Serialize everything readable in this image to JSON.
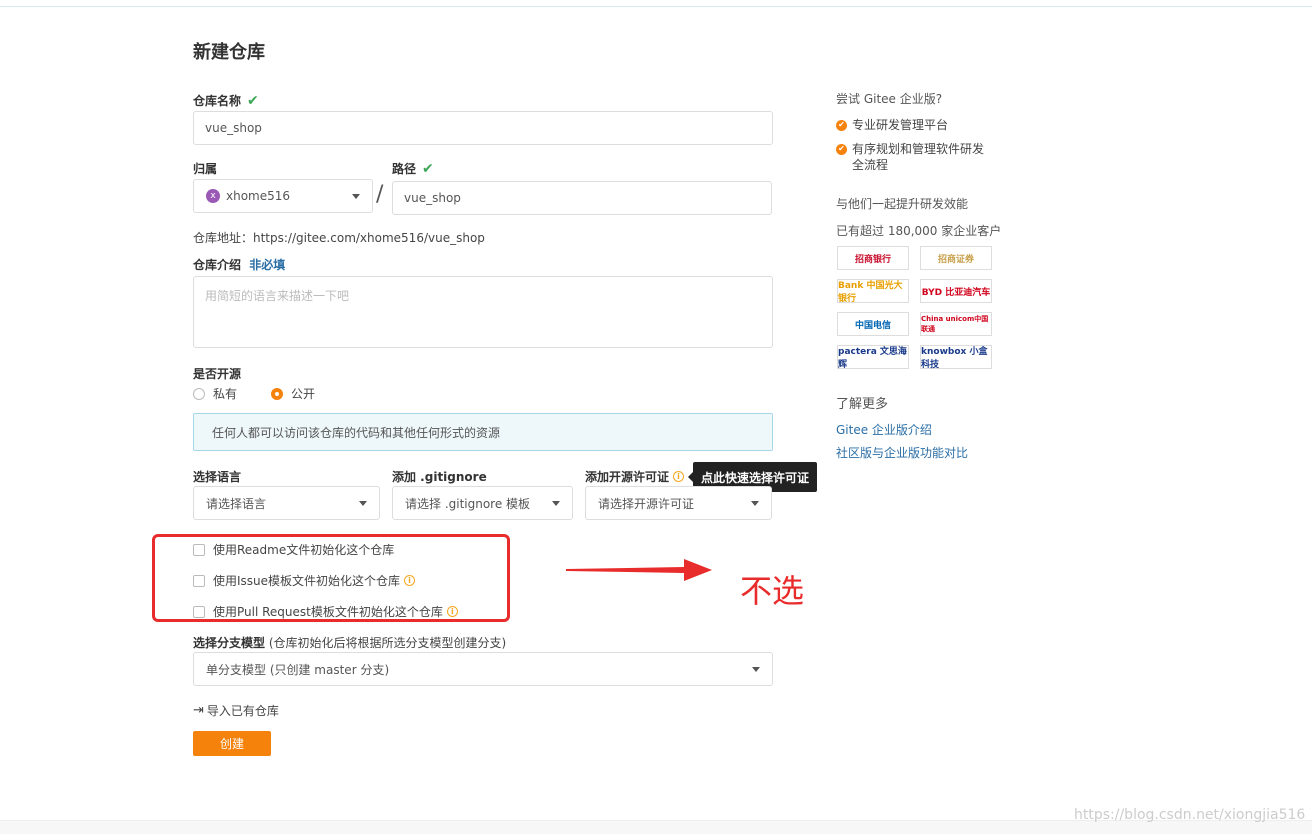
{
  "page": {
    "title": "新建仓库"
  },
  "repo_name": {
    "label": "仓库名称",
    "value": "vue_shop"
  },
  "owner": {
    "label": "归属",
    "avatar_letter": "x",
    "value": "xhome516"
  },
  "path": {
    "label": "路径",
    "separator": "/",
    "value": "vue_shop"
  },
  "repo_url": {
    "text": "仓库地址：https://gitee.com/xhome516/vue_shop"
  },
  "description": {
    "label": "仓库介绍",
    "optional": "非必填",
    "placeholder": "用简短的语言来描述一下吧"
  },
  "visibility": {
    "label": "是否开源",
    "private_label": "私有",
    "public_label": "公开",
    "selected": "公开",
    "notice": "任何人都可以访问该仓库的代码和其他任何形式的资源"
  },
  "language": {
    "label": "选择语言",
    "value": "请选择语言"
  },
  "gitignore": {
    "label": "添加 .gitignore",
    "value": "请选择 .gitignore 模板"
  },
  "license": {
    "label": "添加开源许可证",
    "value": "请选择开源许可证",
    "tooltip": "点此快速选择许可证"
  },
  "init_options": [
    {
      "label": "使用Readme文件初始化这个仓库",
      "checked": false
    },
    {
      "label": "使用Issue模板文件初始化这个仓库",
      "checked": false
    },
    {
      "label": "使用Pull Request模板文件初始化这个仓库",
      "checked": false
    }
  ],
  "annotation": {
    "text": "不选",
    "color": "#e82b2b"
  },
  "branch_model": {
    "label": "选择分支模型",
    "hint": "(仓库初始化后将根据所选分支模型创建分支)",
    "value": "单分支模型 (只创建 master 分支)"
  },
  "import_link": "导入已有仓库",
  "create_button": "创建",
  "sidebar": {
    "try_title": "尝试 Gitee 企业版?",
    "features": [
      "专业研发管理平台",
      "有序规划和管理软件研发",
      "全流程"
    ],
    "together": "与他们一起提升研发效能",
    "customers": "已有超过 180,000 家企业客户",
    "logos": [
      "招商银行",
      "招商证券",
      "Bank 中国光大银行",
      "BYD 比亚迪汽车",
      "中国电信",
      "China unicom中国联通",
      "pactera 文思海辉",
      "knowbox 小盒科技"
    ],
    "learn_more": "了解更多",
    "links": [
      "Gitee 企业版介绍",
      "社区版与企业版功能对比"
    ]
  },
  "watermark": "https://blog.csdn.net/xiongjia516",
  "colors": {
    "accent": "#f5820b",
    "success": "#3aa655",
    "link": "#2a6ea6"
  }
}
